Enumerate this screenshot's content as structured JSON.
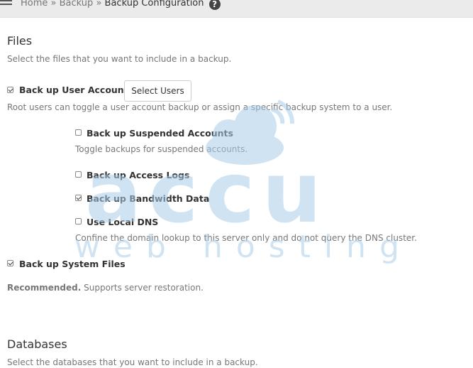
{
  "breadcrumb": {
    "home": "Home",
    "sep1": "»",
    "backup": "Backup",
    "sep2": "»",
    "current": "Backup Configuration",
    "help": "?"
  },
  "files": {
    "title": "Files",
    "description": "Select the files that you want to include in a backup.",
    "user_accounts": {
      "label": "Back up User Accounts",
      "checked": true,
      "button": "Select Users",
      "help": "Root users can toggle a user account backup or assign a specific backup system to a user."
    },
    "suspended": {
      "label": "Back up Suspended Accounts",
      "checked": false,
      "help": "Toggle backups for suspended accounts."
    },
    "access_logs": {
      "label": "Back up Access Logs",
      "checked": false
    },
    "bandwidth": {
      "label": "Back up Bandwidth Data",
      "checked": true
    },
    "local_dns": {
      "label": "Use Local DNS",
      "checked": false,
      "help": "Confine the domain lookup to this server only and do not query the DNS cluster."
    },
    "system_files": {
      "label": "Back up System Files",
      "checked": true,
      "note_strong": "Recommended.",
      "note": "Supports server restoration."
    }
  },
  "databases": {
    "title": "Databases",
    "description": "Select the databases that you want to include in a backup."
  },
  "watermark": {
    "brand": "accu",
    "tagline": "web hosting",
    "color": "#a9cdea"
  }
}
